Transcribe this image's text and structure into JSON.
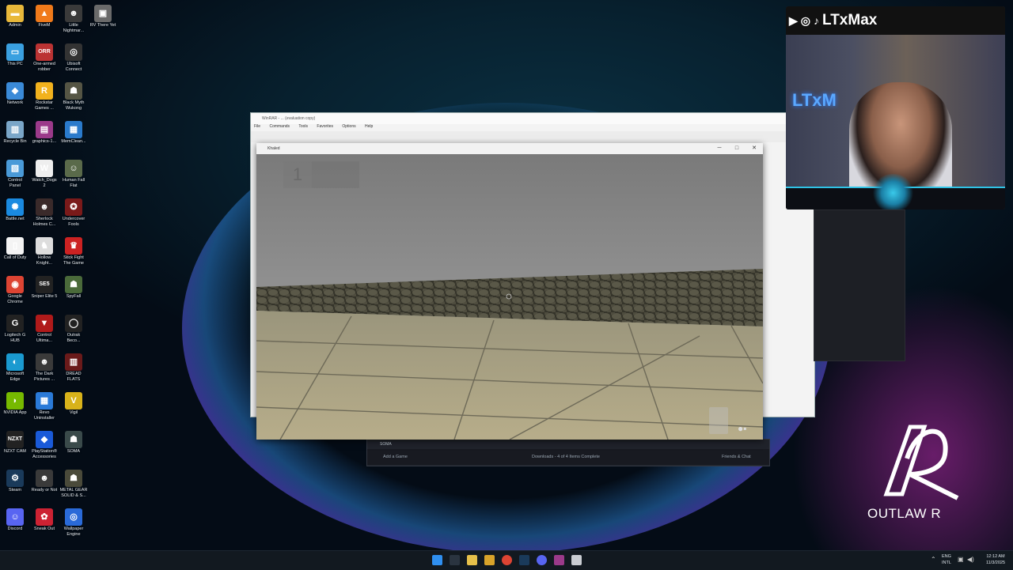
{
  "desktop": {
    "icons": [
      {
        "label": "Admin",
        "icon": "folder-icon",
        "color": "#e8b83a",
        "glyph": "▬"
      },
      {
        "label": "FiveM",
        "icon": "fivem-icon",
        "color": "#f07a1a",
        "glyph": "▲"
      },
      {
        "label": "Little\nNightmar...",
        "icon": "game-icon",
        "color": "#3a3a3a",
        "glyph": "☻"
      },
      {
        "label": "RV There Yet",
        "icon": "game-icon",
        "color": "#6a6a6a",
        "glyph": "▣"
      },
      {
        "label": "This PC",
        "icon": "computer-icon",
        "color": "#3aa0e0",
        "glyph": "▭"
      },
      {
        "label": "One-armed\nrobber",
        "icon": "game-icon",
        "color": "#b33",
        "glyph": "ORR"
      },
      {
        "label": "Ubisoft\nConnect",
        "icon": "ubisoft-icon",
        "color": "#333",
        "glyph": "◎"
      },
      {
        "label": "Network",
        "icon": "network-icon",
        "color": "#3a8ad8",
        "glyph": "◆"
      },
      {
        "label": "Rockstar\nGames ...",
        "icon": "rockstar-icon",
        "color": "#f2b21d",
        "glyph": "R"
      },
      {
        "label": "Black Myth\nWukong",
        "icon": "game-icon",
        "color": "#554",
        "glyph": "☗"
      },
      {
        "label": "Recycle Bin",
        "icon": "recycle-bin-icon",
        "color": "#7aa6c8",
        "glyph": "▥"
      },
      {
        "label": "graphics-1...",
        "icon": "winrar-icon",
        "color": "#9b3a8a",
        "glyph": "▤"
      },
      {
        "label": "MemClean...",
        "icon": "app-icon",
        "color": "#2a7acb",
        "glyph": "▦"
      },
      {
        "label": "Control\nPanel",
        "icon": "control-panel-icon",
        "color": "#4a9ad8",
        "glyph": "▧"
      },
      {
        "label": "Watch_Dogs\n2",
        "icon": "game-icon",
        "color": "#eee",
        "glyph": "W"
      },
      {
        "label": "Human Fall\nFlat",
        "icon": "game-icon",
        "color": "#5a6a4a",
        "glyph": "☺"
      },
      {
        "label": "Battle.net",
        "icon": "battlenet-icon",
        "color": "#1a8ae0",
        "glyph": "✺"
      },
      {
        "label": "Sherlock\nHolmes C...",
        "icon": "game-icon",
        "color": "#3a2a2a",
        "glyph": "☻"
      },
      {
        "label": "Undercover\nFools",
        "icon": "game-icon",
        "color": "#7a1a1a",
        "glyph": "✪"
      },
      {
        "label": "Call of Duty",
        "icon": "file-icon",
        "color": "#f4f4f4",
        "glyph": "▯"
      },
      {
        "label": "Hollow\nKnight...",
        "icon": "game-icon",
        "color": "#ddd",
        "glyph": "♞"
      },
      {
        "label": "Stick Fight\nThe Game",
        "icon": "game-icon",
        "color": "#c22",
        "glyph": "♛"
      },
      {
        "label": "Google\nChrome",
        "icon": "chrome-icon",
        "color": "#dd4433",
        "glyph": "◉"
      },
      {
        "label": "Sniper Elite 5",
        "icon": "game-icon",
        "color": "#222",
        "glyph": "SE5"
      },
      {
        "label": "SpyFall",
        "icon": "game-icon",
        "color": "#4a6a3a",
        "glyph": "☗"
      },
      {
        "label": "Logitech G\nHUB",
        "icon": "logitech-icon",
        "color": "#222",
        "glyph": "G"
      },
      {
        "label": "Control\nUltima...",
        "icon": "game-icon",
        "color": "#b01a1a",
        "glyph": "▼"
      },
      {
        "label": "Outrak\nBeco...",
        "icon": "game-icon",
        "color": "#222",
        "glyph": "◯"
      },
      {
        "label": "Microsoft\nEdge",
        "icon": "edge-icon",
        "color": "#1a9ad0",
        "glyph": "◐"
      },
      {
        "label": "The Dark\nPictures ...",
        "icon": "game-icon",
        "color": "#3a3a3a",
        "glyph": "☻"
      },
      {
        "label": "DREAD\nFLATS",
        "icon": "game-icon",
        "color": "#6a1a1a",
        "glyph": "▥"
      },
      {
        "label": "NVIDIA App",
        "icon": "nvidia-icon",
        "color": "#76b900",
        "glyph": "◗"
      },
      {
        "label": "Revo\nUninstaller",
        "icon": "revo-icon",
        "color": "#2a7ad8",
        "glyph": "▦"
      },
      {
        "label": "Vigil",
        "icon": "game-icon",
        "color": "#d8b21a",
        "glyph": "V"
      },
      {
        "label": "NZXT CAM",
        "icon": "nzxt-icon",
        "color": "#222",
        "glyph": "NZXT"
      },
      {
        "label": "PlayStation®\nAccessories",
        "icon": "playstation-icon",
        "color": "#1a5ad8",
        "glyph": "◆"
      },
      {
        "label": "SOMA",
        "icon": "game-icon",
        "color": "#3a4a4a",
        "glyph": "☗"
      },
      {
        "label": "Steam",
        "icon": "steam-icon",
        "color": "#1a3a5a",
        "glyph": "⚙"
      },
      {
        "label": "Ready or Not",
        "icon": "game-icon",
        "color": "#3a3a3a",
        "glyph": "☻"
      },
      {
        "label": "METAL GEAR\nSOLID & S...",
        "icon": "game-icon",
        "color": "#4a4a3a",
        "glyph": "☗"
      },
      {
        "label": "Discord",
        "icon": "discord-icon",
        "color": "#5865f2",
        "glyph": "☺"
      },
      {
        "label": "Sneak Out",
        "icon": "game-icon",
        "color": "#c23",
        "glyph": "✿"
      },
      {
        "label": "Wallpaper\nEngine",
        "icon": "wallpaper-engine-icon",
        "color": "#2a6ad8",
        "glyph": "◎"
      }
    ]
  },
  "webcam": {
    "handle": "LTxMax",
    "neon_sign": "LTxM",
    "social_icons": [
      "youtube-icon",
      "instagram-icon",
      "tiktok-icon"
    ]
  },
  "background_window": {
    "title": "WinRAR - ... (evaluation copy)",
    "menu": [
      "File",
      "Commands",
      "Tools",
      "Favorites",
      "Options",
      "Help"
    ]
  },
  "game_window": {
    "title": "Khaled",
    "hotbar_slot": "1"
  },
  "steam_window": {
    "game_row": "SOMA",
    "add_game": "Add a Game",
    "downloads": "Downloads - 4 of 4 Items Complete",
    "friends": "Friends & Chat"
  },
  "logo": {
    "wordmark": "OUTLAW R"
  },
  "taskbar": {
    "lang_line1": "ENG",
    "lang_line2": "INTL",
    "time": "12:12 AM",
    "date": "11/3/2025"
  },
  "colors": {
    "accent_cyan": "#2fc3e6",
    "taskbar_bg": "#121920"
  }
}
